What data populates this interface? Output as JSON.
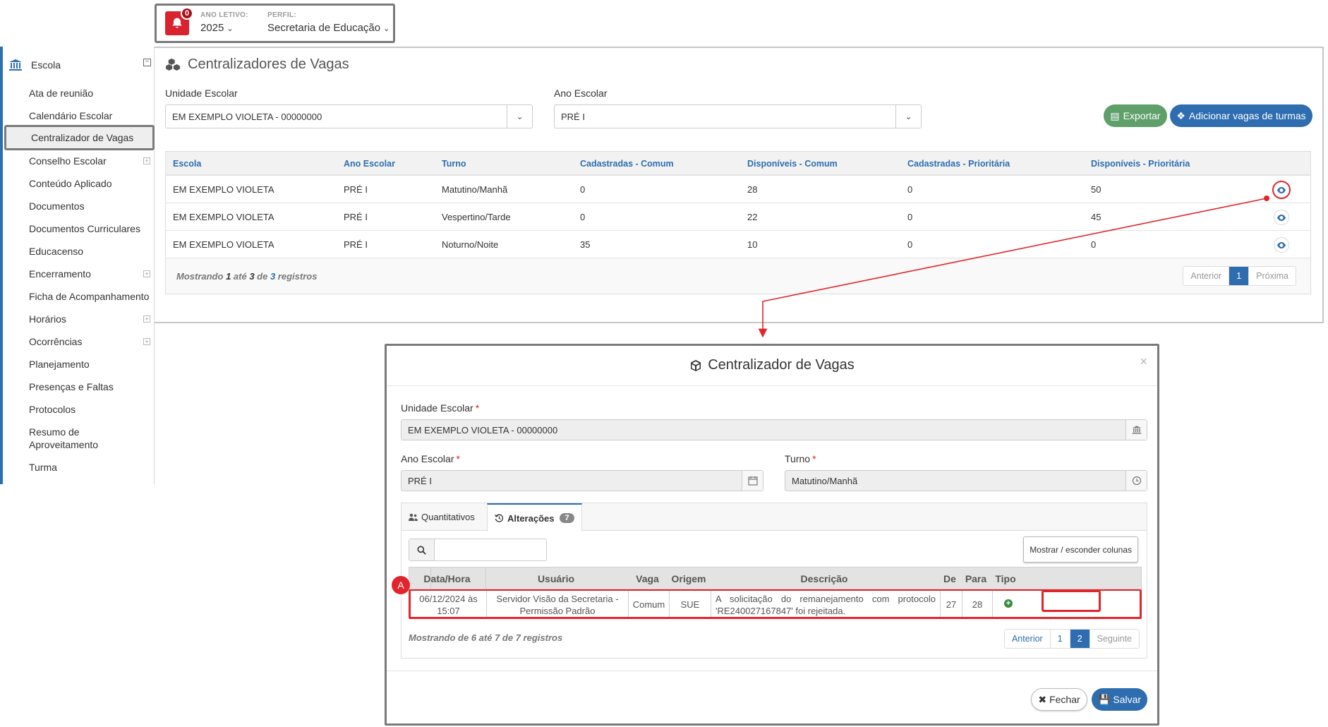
{
  "header": {
    "notification_count": "0",
    "year_label": "ANO LETIVO:",
    "year_value": "2025",
    "profile_label": "PERFIL:",
    "profile_value": "Secretaria de Educação"
  },
  "sidebar": {
    "section": "Escola",
    "items": [
      {
        "label": "Ata de reunião"
      },
      {
        "label": "Calendário Escolar"
      },
      {
        "label": "Centralizador de Vagas"
      },
      {
        "label": "Conselho Escolar"
      },
      {
        "label": "Conteúdo Aplicado"
      },
      {
        "label": "Documentos"
      },
      {
        "label": "Documentos Curriculares"
      },
      {
        "label": "Educacenso"
      },
      {
        "label": "Encerramento"
      },
      {
        "label": "Ficha de Acompanhamento"
      },
      {
        "label": "Horários"
      },
      {
        "label": "Ocorrências"
      },
      {
        "label": "Planejamento"
      },
      {
        "label": "Presenças e Faltas"
      },
      {
        "label": "Protocolos"
      },
      {
        "label": "Resumo de Aproveitamento"
      },
      {
        "label": "Turma"
      }
    ]
  },
  "main": {
    "title": "Centralizadores de Vagas",
    "unit_label": "Unidade Escolar",
    "unit_value": "EM EXEMPLO VIOLETA - 00000000",
    "grade_label": "Ano Escolar",
    "grade_value": "PRÉ I",
    "export_label": "Exportar",
    "add_label": "Adicionar vagas de turmas",
    "columns": [
      "Escola",
      "Ano Escolar",
      "Turno",
      "Cadastradas - Comum",
      "Disponíveis - Comum",
      "Cadastradas - Prioritária",
      "Disponíveis - Prioritária"
    ],
    "rows": [
      [
        "EM EXEMPLO VIOLETA",
        "PRÉ I",
        "Matutino/Manhã",
        "0",
        "28",
        "0",
        "50"
      ],
      [
        "EM EXEMPLO VIOLETA",
        "PRÉ I",
        "Vespertino/Tarde",
        "0",
        "22",
        "0",
        "45"
      ],
      [
        "EM EXEMPLO VIOLETA",
        "PRÉ I",
        "Noturno/Noite",
        "35",
        "10",
        "0",
        "0"
      ]
    ],
    "footer": {
      "p1": "Mostrando ",
      "n1": "1",
      "p2": " até ",
      "n2": "3",
      "p3": " de ",
      "n3": "3",
      "p4": " registros"
    },
    "pager": {
      "prev": "Anterior",
      "page": "1",
      "next": "Próxima"
    }
  },
  "modal": {
    "title": "Centralizador de Vagas",
    "close": "×",
    "unit_label": "Unidade Escolar",
    "unit_value": "EM EXEMPLO VIOLETA - 00000000",
    "grade_label": "Ano Escolar",
    "grade_value": "PRÉ I",
    "shift_label": "Turno",
    "shift_value": "Matutino/Manhã",
    "required_mark": "*",
    "tabs": {
      "quant": "Quantitativos",
      "changes": "Alterações",
      "changes_count": "7"
    },
    "toggle_columns": "Mostrar / esconder colunas",
    "columns": [
      "Data/Hora",
      "Usuário",
      "Vaga",
      "Origem",
      "Descrição",
      "De",
      "Para",
      "Tipo"
    ],
    "row": {
      "datetime": "06/12/2024 às 15:07",
      "user": "Servidor Visão da Secretaria - Permissão Padrão",
      "vaga": "Comum",
      "origem": "SUE",
      "descricao": "A solicitação do remanejamento com protocolo 'RE240027167847' foi rejeitada.",
      "de": "27",
      "para": "28"
    },
    "footer": "Mostrando de 6 até 7 de 7 registros",
    "pager": {
      "prev": "Anterior",
      "p1": "1",
      "p2": "2",
      "next": "Seguinte"
    },
    "close_label": "Fechar",
    "save_label": "Salvar"
  },
  "annotation_marker": "A",
  "colors": {
    "accent": "#2e6db0",
    "highlight": "#e0262c",
    "export": "#5e9f6a",
    "alert": "#d9232f"
  }
}
